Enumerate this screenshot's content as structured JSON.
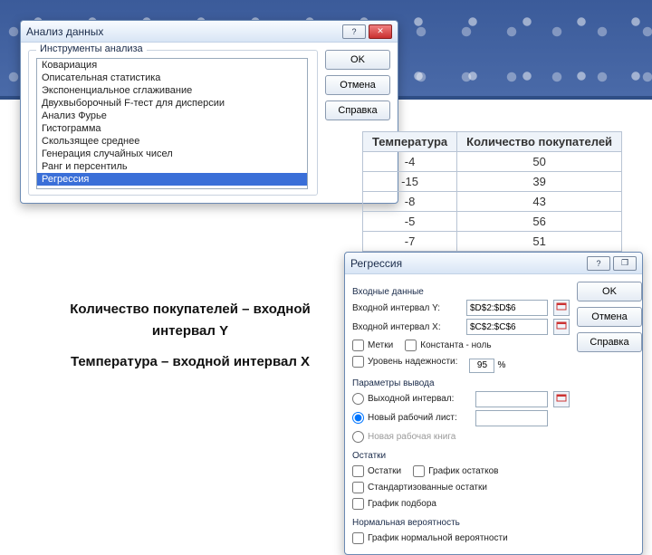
{
  "banner": {},
  "dialog_analysis": {
    "title": "Анализ данных",
    "group_label": "Инструменты анализа",
    "items": [
      "Ковариация",
      "Описательная статистика",
      "Экспоненциальное сглаживание",
      "Двухвыборочный F-тест для дисперсии",
      "Анализ Фурье",
      "Гистограмма",
      "Скользящее среднее",
      "Генерация случайных чисел",
      "Ранг и персентиль",
      "Регрессия"
    ],
    "selected_index": 9,
    "buttons": {
      "ok": "OK",
      "cancel": "Отмена",
      "help": "Справка"
    }
  },
  "table": {
    "headers": [
      "Температура",
      "Количество покупателей"
    ],
    "rows": [
      [
        "-4",
        "50"
      ],
      [
        "-15",
        "39"
      ],
      [
        "-8",
        "43"
      ],
      [
        "-5",
        "56"
      ],
      [
        "-7",
        "51"
      ]
    ]
  },
  "note": {
    "line1": "Количество покупателей – входной интервал Y",
    "line2": "Температура – входной интервал X"
  },
  "dialog_reg": {
    "title": "Регрессия",
    "sections": {
      "input": "Входные данные",
      "output": "Параметры вывода",
      "resid": "Остатки",
      "norm": "Нормальная вероятность"
    },
    "labels": {
      "y": "Входной интервал Y:",
      "x": "Входной интервал X:",
      "tags": "Метки",
      "const0": "Константа - ноль",
      "conf": "Уровень надежности:",
      "conf_val": "95",
      "percent": "%",
      "out_range": "Выходной интервал:",
      "new_sheet": "Новый рабочий лист:",
      "new_book": "Новая рабочая книга",
      "resid": "Остатки",
      "resid_plot": "График остатков",
      "std_resid": "Стандартизованные остатки",
      "fit_plot": "График подбора",
      "norm_plot": "График нормальной вероятности"
    },
    "values": {
      "y": "$D$2:$D$6",
      "x": "$C$2:$C$6"
    },
    "buttons": {
      "ok": "OK",
      "cancel": "Отмена",
      "help": "Справка"
    }
  },
  "icons": {
    "help": "?",
    "min": "—",
    "close": "✕",
    "restore": "❐"
  }
}
